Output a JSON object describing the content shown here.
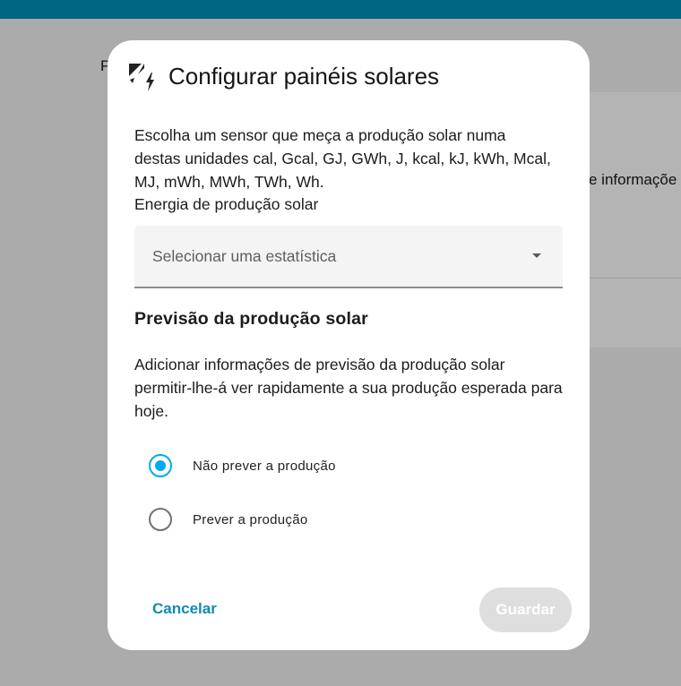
{
  "background": {
    "partial_letter": "P",
    "partial_text": "e informaçõe"
  },
  "dialog": {
    "icon": "solar-power-icon",
    "title": "Configurar painéis solares",
    "description": "Escolha um sensor que meça a produção solar numa destas unidades cal, Gcal, GJ, GWh, J, kcal, kJ, kWh, Mcal, MJ, mWh, MWh, TWh, Wh.",
    "field_label": "Energia de produção solar",
    "select_placeholder": "Selecionar uma estatística",
    "forecast_title": "Previsão da produção solar",
    "forecast_text": "Adicionar informações de previsão da produção solar permitir-lhe-á ver rapidamente a sua produção esperada para hoje.",
    "radio_options": [
      {
        "label": "Não prever a produção",
        "checked": true
      },
      {
        "label": "Prever a produção",
        "checked": false
      }
    ],
    "cancel_label": "Cancelar",
    "save_label": "Guardar"
  },
  "colors": {
    "accent": "#03a9f4",
    "topbar": "#006583",
    "cancel_text": "#0d8bb3",
    "save_disabled": "#dedede"
  }
}
